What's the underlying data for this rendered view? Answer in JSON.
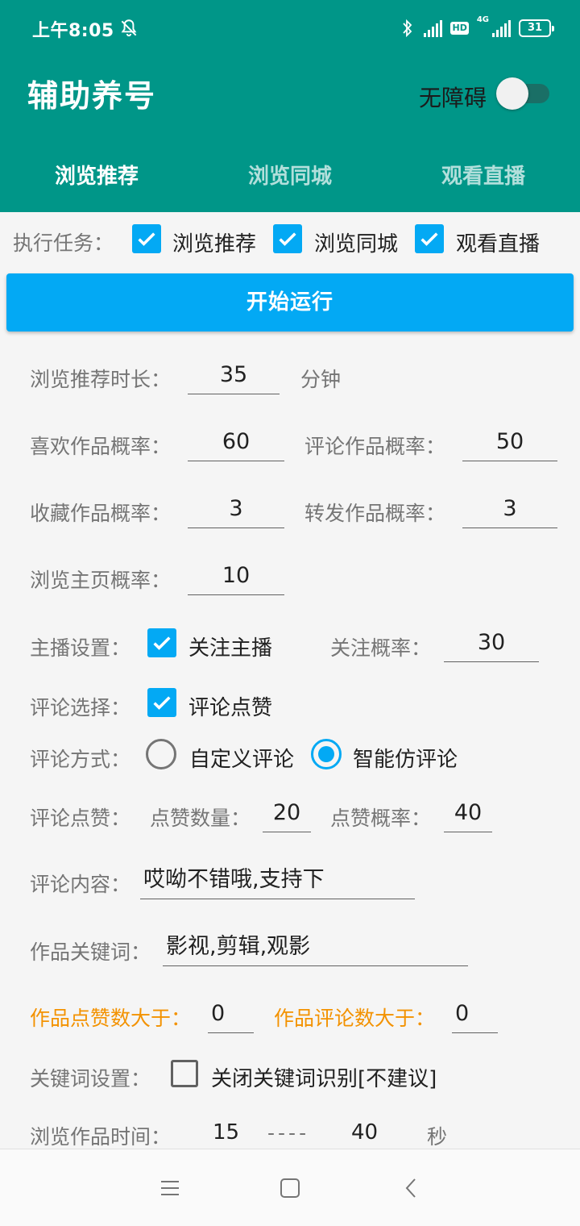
{
  "status_bar": {
    "time": "上午8:05",
    "hd": "HD",
    "network": "4G",
    "battery": "31"
  },
  "app": {
    "title": "辅助养号",
    "accessibility_label": "无障碍",
    "accessibility_enabled": false
  },
  "tabs": [
    {
      "label": "浏览推荐",
      "selected": true
    },
    {
      "label": "浏览同城",
      "selected": false
    },
    {
      "label": "观看直播",
      "selected": false
    }
  ],
  "tasks": {
    "label": "执行任务：",
    "options": [
      {
        "label": "浏览推荐",
        "checked": true
      },
      {
        "label": "浏览同城",
        "checked": true
      },
      {
        "label": "观看直播",
        "checked": true
      }
    ]
  },
  "start_button": "开始运行",
  "form": {
    "browse_duration": {
      "label": "浏览推荐时长：",
      "value": "35",
      "unit": "分钟"
    },
    "like_prob": {
      "label": "喜欢作品概率：",
      "value": "60"
    },
    "comment_prob": {
      "label": "评论作品概率：",
      "value": "50"
    },
    "collect_prob": {
      "label": "收藏作品概率：",
      "value": "3"
    },
    "forward_prob": {
      "label": "转发作品概率：",
      "value": "3"
    },
    "homepage_prob": {
      "label": "浏览主页概率：",
      "value": "10"
    },
    "streamer": {
      "label": "主播设置：",
      "follow_label": "关注主播",
      "follow_checked": true,
      "prob_label": "关注概率：",
      "prob_value": "30"
    },
    "comment_select": {
      "label": "评论选择：",
      "like_label": "评论点赞",
      "like_checked": true
    },
    "comment_mode": {
      "label": "评论方式：",
      "options": [
        "自定义评论",
        "智能仿评论"
      ],
      "selected": "智能仿评论"
    },
    "comment_like": {
      "label": "评论点赞：",
      "count_label": "点赞数量：",
      "count_value": "20",
      "prob_label": "点赞概率：",
      "prob_value": "40"
    },
    "comment_content": {
      "label": "评论内容：",
      "value": "哎呦不错哦,支持下"
    },
    "keywords": {
      "label": "作品关键词：",
      "value": "影视,剪辑,观影"
    },
    "like_threshold": {
      "label": "作品点赞数大于：",
      "value": "0"
    },
    "comment_threshold": {
      "label": "作品评论数大于：",
      "value": "0"
    },
    "keyword_setting": {
      "label": "关键词设置：",
      "option_label": "关闭关键词识别[不建议]",
      "checked": false
    },
    "browse_time": {
      "label": "浏览作品时间：",
      "min": "15",
      "separator": "----",
      "max": "40",
      "unit": "秒"
    }
  },
  "colors": {
    "header": "#009688",
    "accent": "#03a9f4",
    "warning": "#f39200"
  },
  "icons": {
    "bell": "bell-off-icon",
    "bluetooth": "bluetooth-icon",
    "nav": [
      "menu-icon",
      "home-square-icon",
      "back-icon"
    ]
  }
}
